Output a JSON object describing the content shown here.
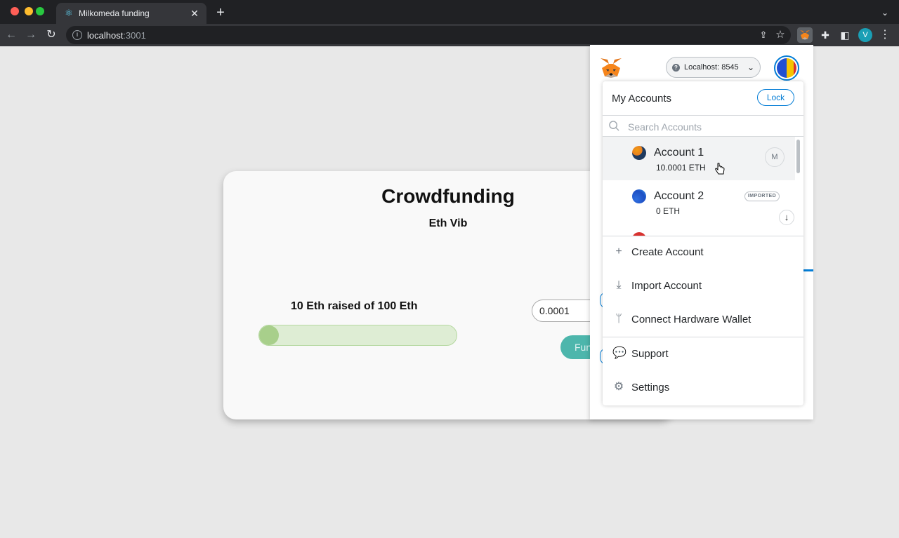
{
  "browser": {
    "tab_title": "Milkomeda funding",
    "url_host": "localhost",
    "url_port": ":3001",
    "profile_initial": "V",
    "tab_close_label": "✕",
    "new_tab_label": "+"
  },
  "page": {
    "title": "Crowdfunding",
    "subtitle": "Eth Vib",
    "raised_text": "10 Eth raised of 100 Eth",
    "progress_fraction": 0.1,
    "amount_value": "0.0001",
    "fund_label": "Fun",
    "accent_color": "#4db6ac"
  },
  "metamask": {
    "network_label": "Localhost: 8545",
    "menu_title": "My Accounts",
    "lock_label": "Lock",
    "search_placeholder": "Search Accounts",
    "accounts": [
      {
        "name": "Account 1",
        "balance": "10.0001 ETH",
        "badge": "M",
        "selected": true
      },
      {
        "name": "Account 2",
        "balance": "0 ETH",
        "badge": "IMPORTED",
        "selected": false
      }
    ],
    "menu_items": [
      {
        "label": "Create Account",
        "icon": "plus-icon"
      },
      {
        "label": "Import Account",
        "icon": "download-icon"
      },
      {
        "label": "Connect Hardware Wallet",
        "icon": "usb-icon"
      },
      {
        "label": "Support",
        "icon": "chat-icon"
      },
      {
        "label": "Settings",
        "icon": "gear-icon"
      }
    ],
    "brand_color": "#037dd6"
  }
}
